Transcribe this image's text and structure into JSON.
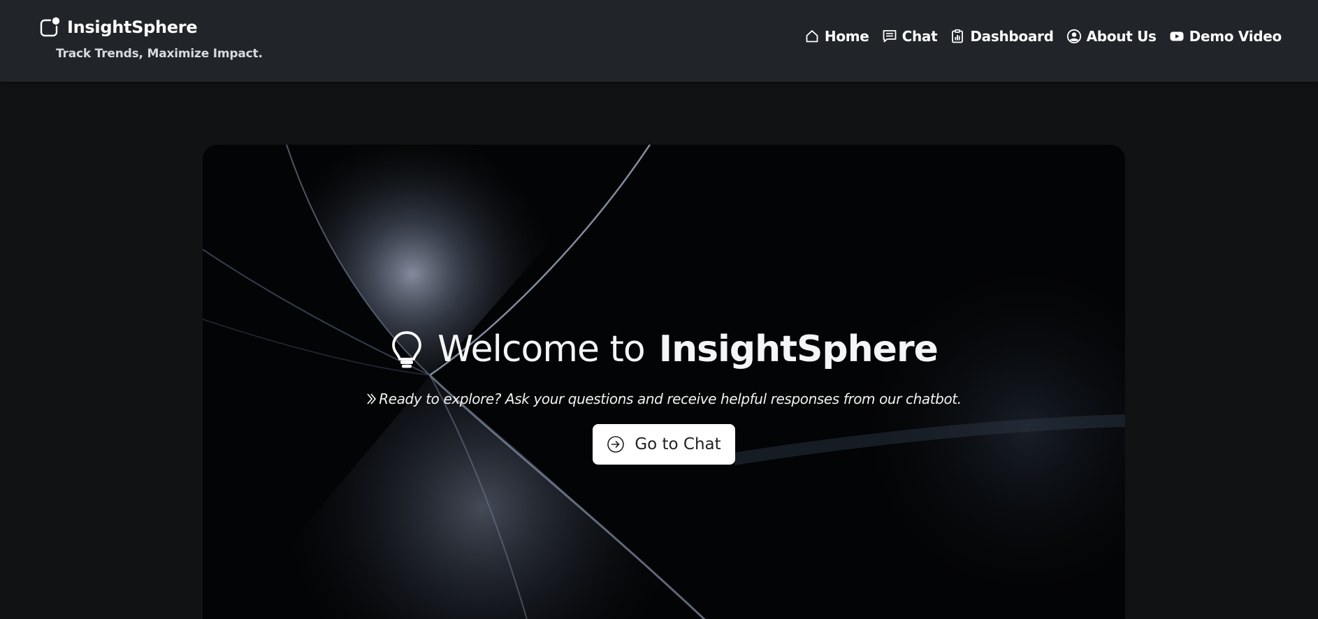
{
  "brand": {
    "name": "InsightSphere",
    "tagline": "Track Trends, Maximize Impact.",
    "icon": "app-indicator-icon"
  },
  "nav": {
    "items": [
      {
        "label": "Home",
        "icon": "house-icon"
      },
      {
        "label": "Chat",
        "icon": "chat-icon"
      },
      {
        "label": "Dashboard",
        "icon": "clipboard-data-icon"
      },
      {
        "label": "About Us",
        "icon": "person-circle-icon"
      },
      {
        "label": "Demo Video",
        "icon": "youtube-icon"
      }
    ]
  },
  "hero": {
    "title_prefix": "Welcome to",
    "title_brand": "InsightSphere",
    "title_icon": "lightbulb-icon",
    "subtitle": "Ready to explore? Ask your questions and receive helpful responses from our chatbot.",
    "subtitle_icon": "chevron-double-right-icon",
    "cta_label": "Go to Chat",
    "cta_icon": "arrow-right-circle-icon"
  },
  "colors": {
    "navbar_bg": "#212529",
    "page_bg": "#111213",
    "hero_bg": "#030405",
    "cta_bg": "#ffffff"
  }
}
